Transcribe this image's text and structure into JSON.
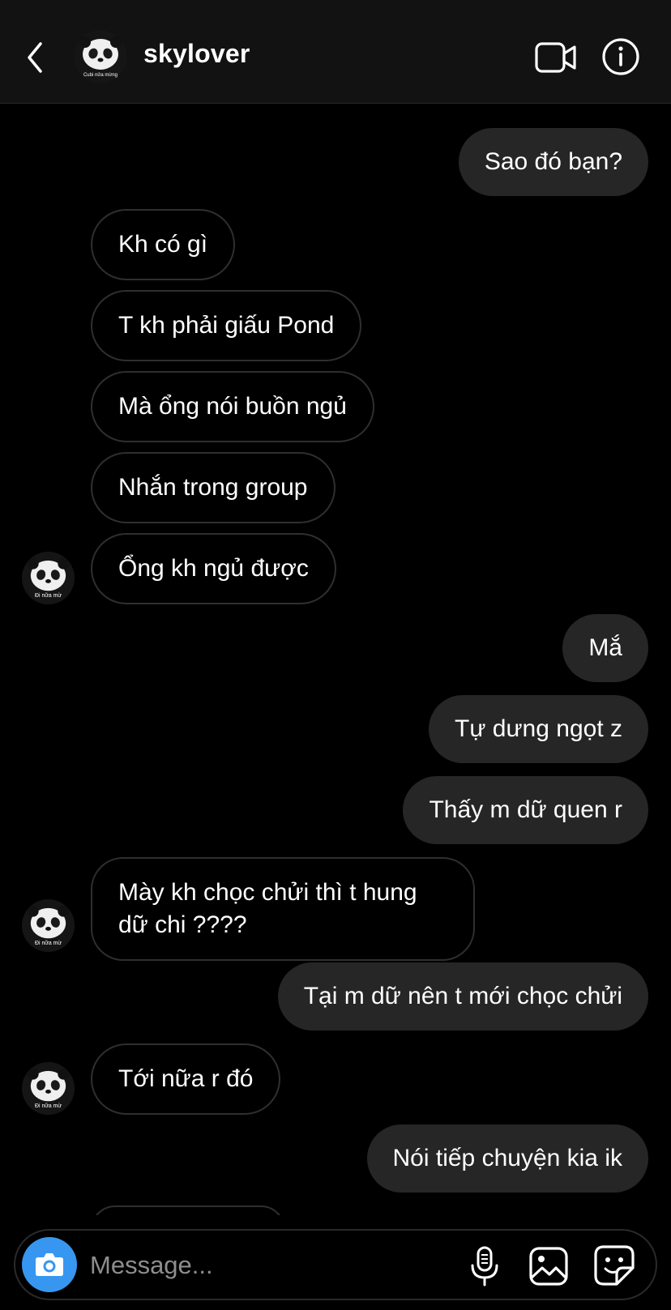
{
  "header": {
    "username": "skylover",
    "avatar_caption": "Cubi nửa mừng",
    "icons": {
      "back": "chevron-left-icon",
      "video": "video-camera-icon",
      "info": "info-icon"
    }
  },
  "messages": [
    {
      "side": "out",
      "text": "Sao đó bạn?"
    },
    {
      "side": "in",
      "text": "Kh có gì"
    },
    {
      "side": "in",
      "text": "T kh phải giấu Pond"
    },
    {
      "side": "in",
      "text": "Mà ổng nói buồn ngủ"
    },
    {
      "side": "in",
      "text": "Nhắn trong group"
    },
    {
      "side": "in",
      "text": "Ổng kh ngủ được"
    },
    {
      "side": "out",
      "text": "Mắ"
    },
    {
      "side": "out",
      "text": "Tự dưng ngọt z"
    },
    {
      "side": "out",
      "text": "Thấy m dữ quen r"
    },
    {
      "side": "in",
      "text": "Mày kh chọc chửi thì t hung dữ chi ????"
    },
    {
      "side": "out",
      "text": "Tại m dữ nên t mới chọc chửi"
    },
    {
      "side": "in",
      "text": "Tới nữa r đó"
    },
    {
      "side": "out",
      "text": "Nói tiếp chuyện kia ik"
    }
  ],
  "avatar_label": "Đi nữa mừ",
  "composer": {
    "placeholder": "Message...",
    "icons": {
      "camera": "camera-icon",
      "mic": "microphone-icon",
      "gallery": "gallery-icon",
      "sticker": "sticker-icon"
    }
  },
  "colors": {
    "background": "#000000",
    "outgoing_bubble": "#262626",
    "camera_button": "#3797f0"
  }
}
